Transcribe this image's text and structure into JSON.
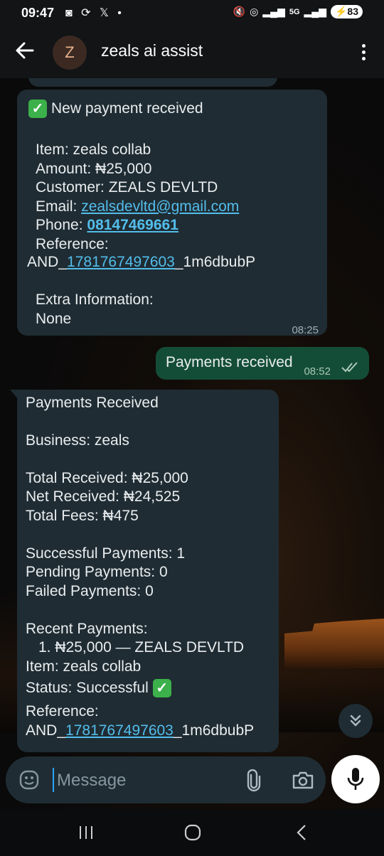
{
  "status_bar": {
    "time": "09:47",
    "left_icons": "◙ ⟳ 𝕏 •",
    "network": "5G",
    "battery": "83"
  },
  "header": {
    "avatar_letter": "Z",
    "title": "zeals ai assist"
  },
  "messages": {
    "m1": {
      "heading": "New payment received",
      "item": "Item: zeals collab",
      "amount": "Amount: ₦25,000",
      "customer": "Customer: ZEALS DEVLTD",
      "email_label": "Email: ",
      "email": "zealsdevltd@gmail.com",
      "phone_label": "Phone: ",
      "phone": "08147469661",
      "reference_label": "Reference:",
      "ref_prefix": "AND_",
      "ref_number": "1781767497603",
      "ref_suffix": "_1m6dbubP",
      "extra_label": "Extra Information:",
      "extra_value": "None",
      "time": "08:25"
    },
    "m2": {
      "text": "Payments received",
      "time": "08:52"
    },
    "m3": {
      "title": "Payments Received",
      "business": "Business: zeals",
      "total_received": "Total Received: ₦25,000",
      "net_received": "Net Received: ₦24,525",
      "total_fees": "Total Fees: ₦475",
      "successful": "Successful Payments: 1",
      "pending": "Pending Payments: 0",
      "failed": "Failed Payments: 0",
      "recent_label": "Recent Payments:",
      "recent_item": "1. ₦25,000 — ZEALS DEVLTD",
      "item": "Item: zeals collab",
      "status": "Status: Successful",
      "reference_label": "Reference:",
      "ref_prefix": "AND_",
      "ref_number": "1781767497603",
      "ref_suffix": "_1m6dbubP"
    }
  },
  "input": {
    "placeholder": "Message"
  },
  "colors": {
    "incoming_bubble": "#1f2c33",
    "outgoing_bubble": "#144d37",
    "link": "#53bdeb",
    "check_green": "#3cb04a"
  }
}
